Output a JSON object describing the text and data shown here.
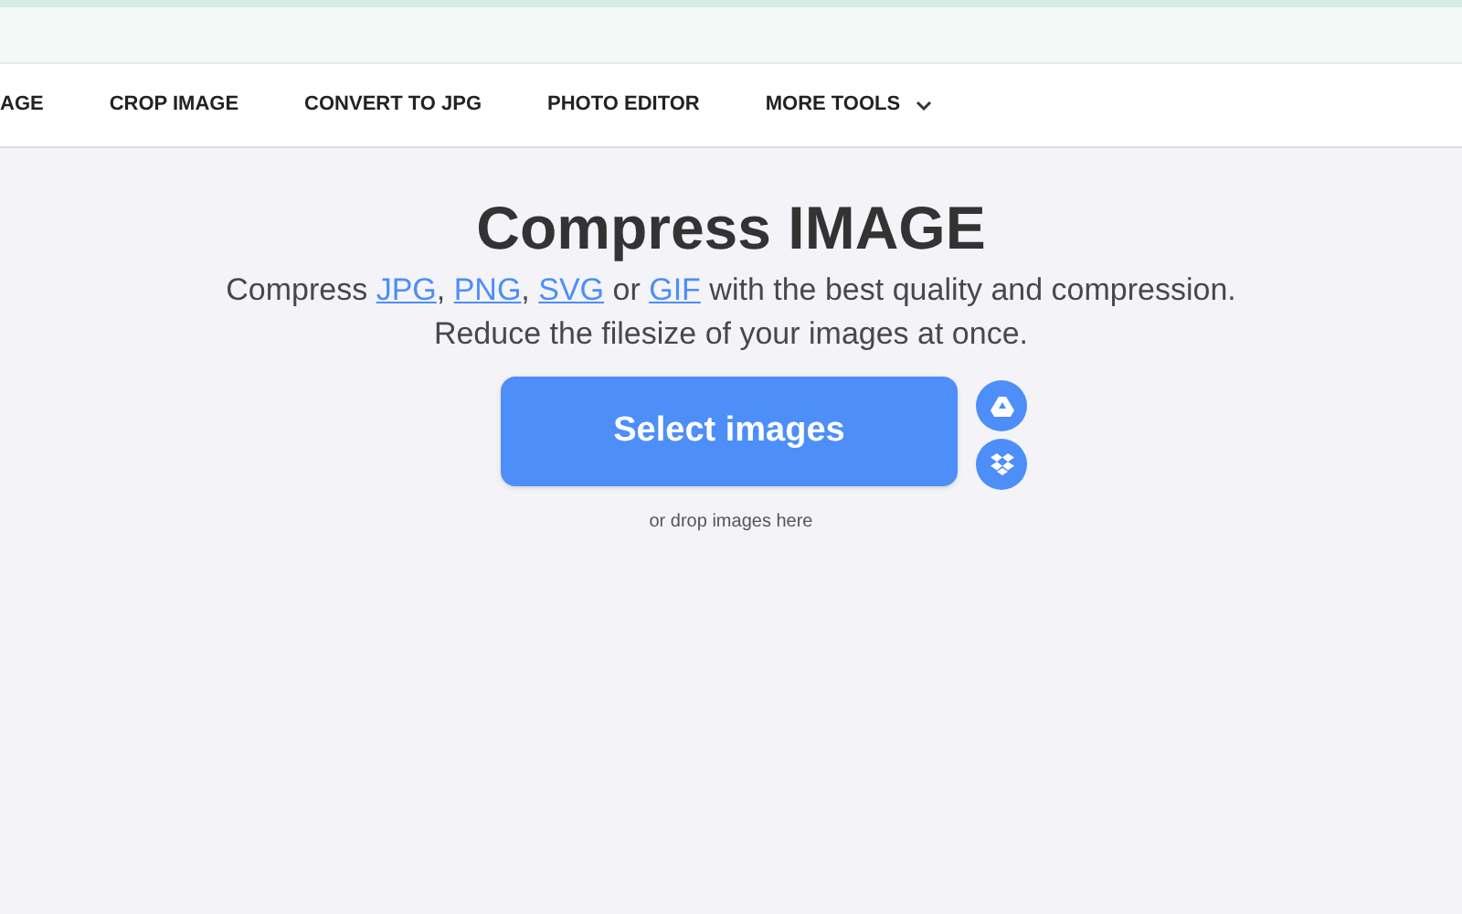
{
  "nav": {
    "items": [
      {
        "label": "AGE",
        "kind": "link"
      },
      {
        "label": "CROP IMAGE",
        "kind": "link"
      },
      {
        "label": "CONVERT TO JPG",
        "kind": "link"
      },
      {
        "label": "PHOTO EDITOR",
        "kind": "link"
      },
      {
        "label": "MORE TOOLS",
        "kind": "dropdown"
      }
    ]
  },
  "title": "Compress IMAGE",
  "subtitle": [
    {
      "kind": "text",
      "text": "Compress "
    },
    {
      "kind": "link",
      "text": "JPG"
    },
    {
      "kind": "text",
      "text": ", "
    },
    {
      "kind": "link",
      "text": "PNG"
    },
    {
      "kind": "text",
      "text": ", "
    },
    {
      "kind": "link",
      "text": "SVG"
    },
    {
      "kind": "text",
      "text": " or "
    },
    {
      "kind": "link",
      "text": "GIF"
    },
    {
      "kind": "text",
      "text": " with the best quality and compression."
    }
  ],
  "subtitle_line2": "Reduce the filesize of your images at once.",
  "upload": {
    "button": "Select images",
    "hint": "or drop images here"
  }
}
